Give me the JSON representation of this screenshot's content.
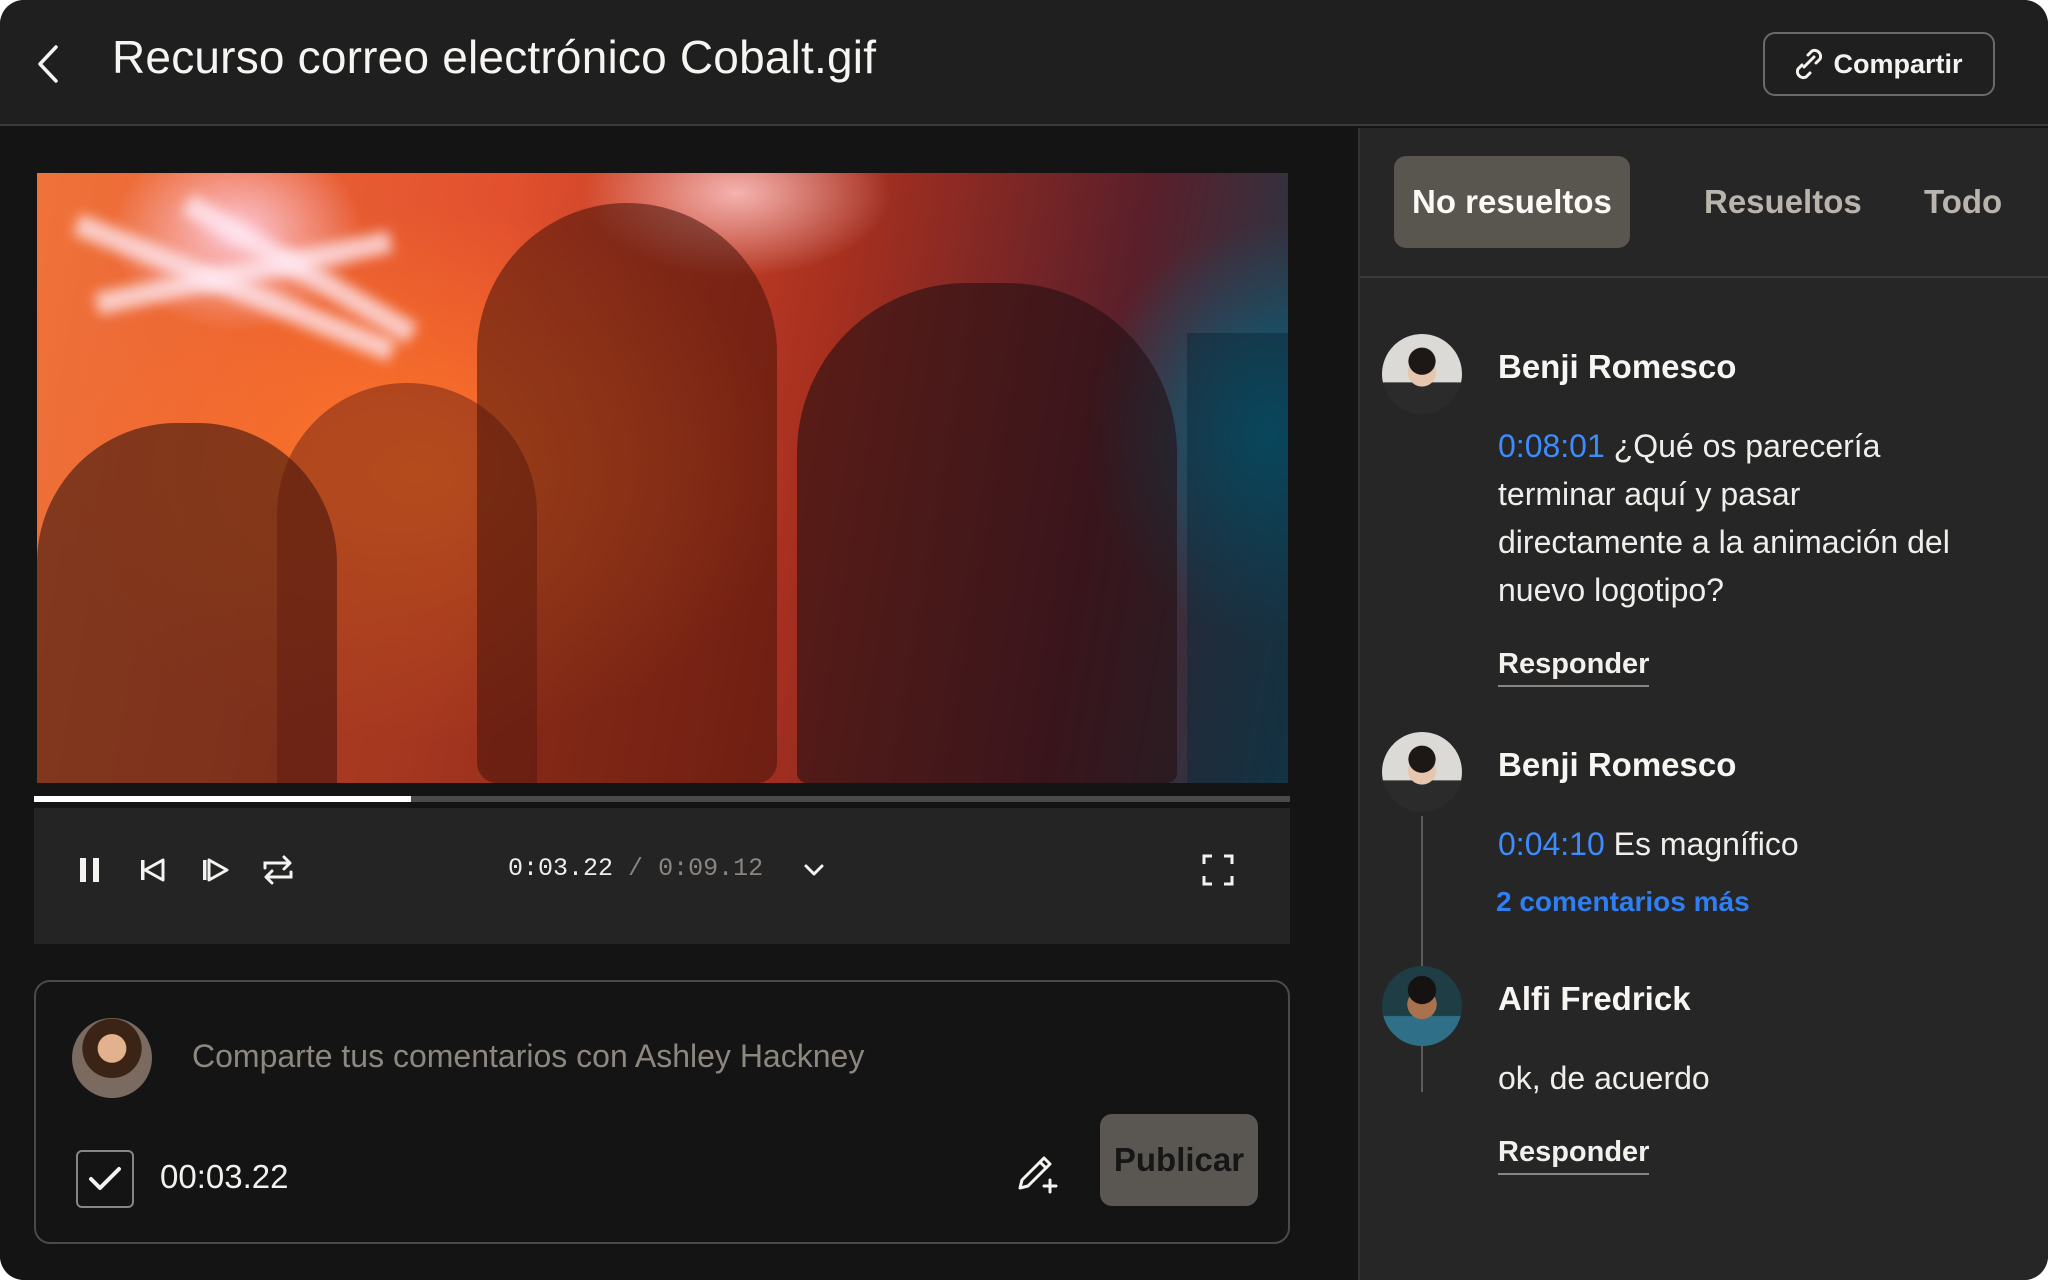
{
  "header": {
    "title": "Recurso correo electrónico Cobalt.gif",
    "share_label": "Compartir",
    "back_icon": "chevron-left-icon",
    "share_icon": "link-icon"
  },
  "player": {
    "progress": 0.3,
    "current_time": "0:03.22",
    "separator": "/",
    "total_time": "0:09.12",
    "controls": [
      "pause-icon",
      "step-back-icon",
      "step-forward-icon",
      "loop-icon",
      "chevron-down-icon",
      "fullscreen-icon"
    ]
  },
  "composer": {
    "placeholder": "Comparte tus comentarios con Ashley Hackney",
    "timestamp": "00:03.22",
    "timestamp_checked": true,
    "publish_label": "Publicar"
  },
  "tabs": [
    {
      "label": "No resueltos",
      "active": true
    },
    {
      "label": "Resueltos",
      "active": false
    },
    {
      "label": "Todo",
      "active": false
    }
  ],
  "comments": [
    {
      "author": "Benji Romesco",
      "time": "0:08:01",
      "text": "¿Qué os parecería terminar aquí y pasar directamente a la animación del nuevo logotipo?",
      "reply_label": "Responder"
    },
    {
      "author": "Benji Romesco",
      "time": "0:04:10",
      "text": "Es magnífico",
      "more_label": "2 comentarios más"
    },
    {
      "author": "Alfi Fredrick",
      "time": "",
      "text": "ok, de acuerdo",
      "reply_label": "Responder"
    }
  ],
  "colors": {
    "accent": "#3d8bfd",
    "background": "#141414",
    "panel": "#262626",
    "active_tab": "#59554f"
  }
}
